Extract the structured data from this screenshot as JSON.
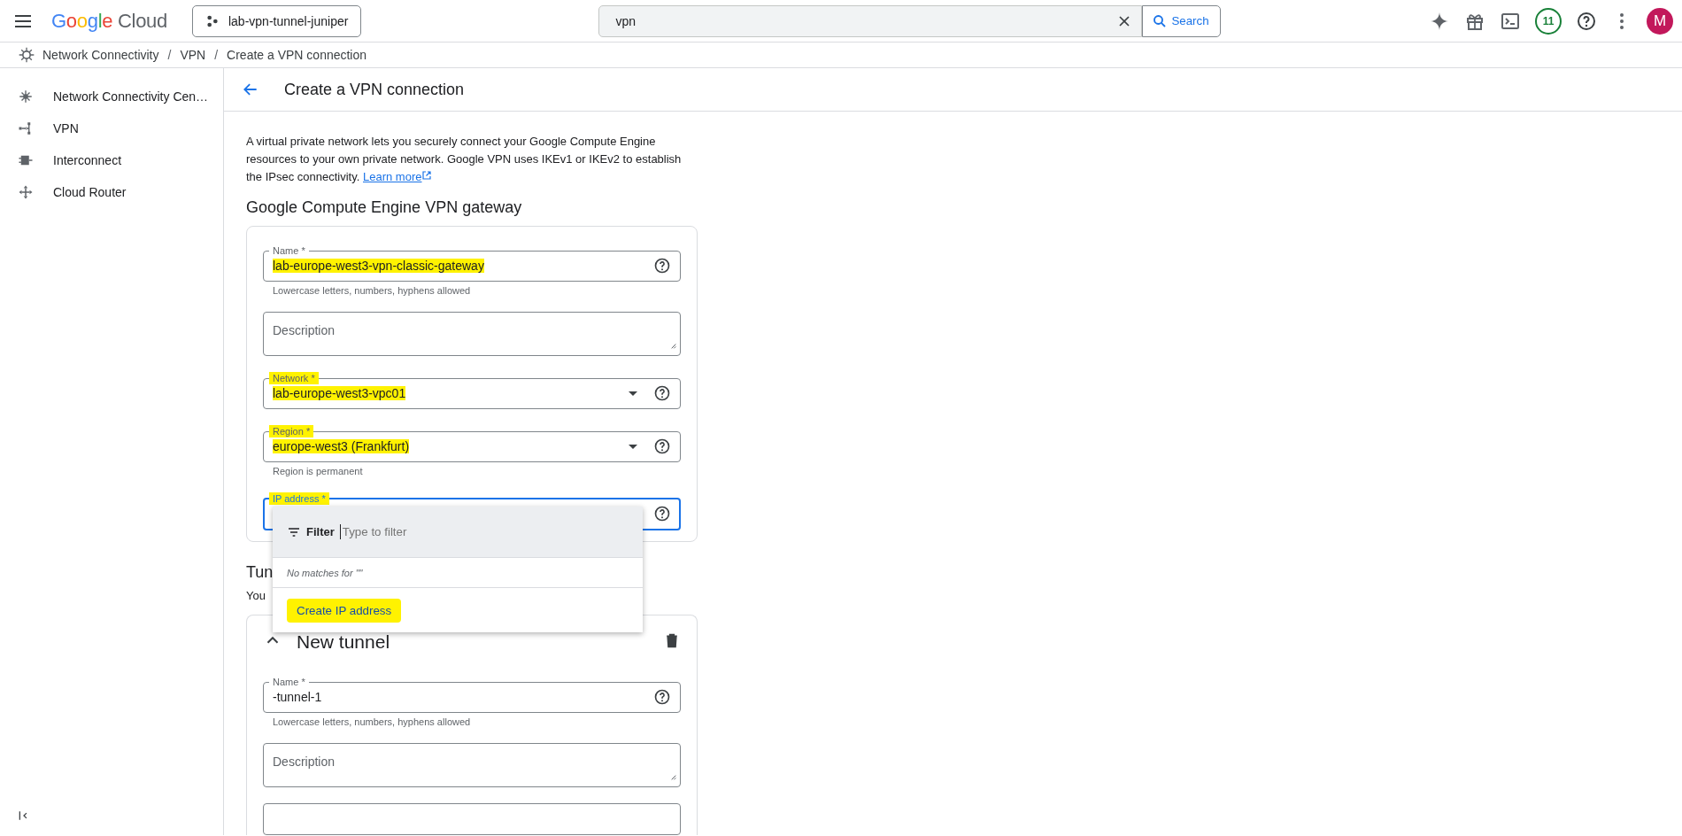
{
  "topbar": {
    "product": "Google Cloud",
    "project": "lab-vpn-tunnel-juniper",
    "search": {
      "value": "vpn"
    },
    "search_button": "Search",
    "notifications": "11",
    "avatar": "M"
  },
  "breadcrumb": [
    {
      "kind": "link",
      "label": "Network Connectivity"
    },
    {
      "kind": "separator",
      "label": "/"
    },
    {
      "kind": "link",
      "label": "VPN"
    },
    {
      "kind": "separator",
      "label": "/"
    },
    {
      "kind": "current",
      "label": "Create a VPN connection"
    }
  ],
  "sidebar": {
    "items": [
      {
        "kind": "hub",
        "label": "Network Connectivity Cen…"
      },
      {
        "kind": "vpn",
        "label": "VPN"
      },
      {
        "kind": "interconnect",
        "label": "Interconnect"
      },
      {
        "kind": "router",
        "label": "Cloud Router"
      }
    ]
  },
  "page": {
    "title": "Create a VPN connection",
    "intro": "A virtual private network lets you securely connect your Google Compute Engine resources to your own private network. Google VPN uses IKEv1 or IKEv2 to establish the IPsec connectivity.",
    "learn_more": "Learn more",
    "section_title": "Google Compute Engine VPN gateway"
  },
  "gateway_fields": [
    {
      "kind": "text",
      "label": "Name *",
      "value": "lab-europe-west3-vpn-classic-gateway",
      "hint": "Lowercase letters, numbers, hyphens allowed",
      "help": true,
      "value_highlighted": true
    },
    {
      "kind": "textarea",
      "placeholder": "Description"
    },
    {
      "kind": "select",
      "label": "Network *",
      "value": "lab-europe-west3-vpc01",
      "help": true,
      "label_highlighted": true,
      "value_highlighted": true
    },
    {
      "kind": "select",
      "label": "Region *",
      "value": "europe-west3 (Frankfurt)",
      "hint": "Region is permanent",
      "help": true,
      "label_highlighted": true,
      "value_highlighted": true
    },
    {
      "kind": "select",
      "label": "IP address *",
      "help": true,
      "focused": true,
      "label_highlighted": true
    }
  ],
  "ip_dropdown": {
    "filter_label": "Filter",
    "filter_placeholder": "Type to filter",
    "empty_message": "No matches for \"\"",
    "action": "Create IP address",
    "action_highlighted": true
  },
  "tunnels_section": {
    "title": "Tun",
    "text": "You"
  },
  "tunnel": {
    "title": "New tunnel",
    "expanded": true,
    "fields": [
      {
        "kind": "text",
        "label": "Name *",
        "value": "-tunnel-1",
        "hint": "Lowercase letters, numbers, hyphens allowed",
        "help": true
      },
      {
        "kind": "textarea",
        "placeholder": "Description"
      },
      {
        "kind": "text"
      }
    ]
  }
}
